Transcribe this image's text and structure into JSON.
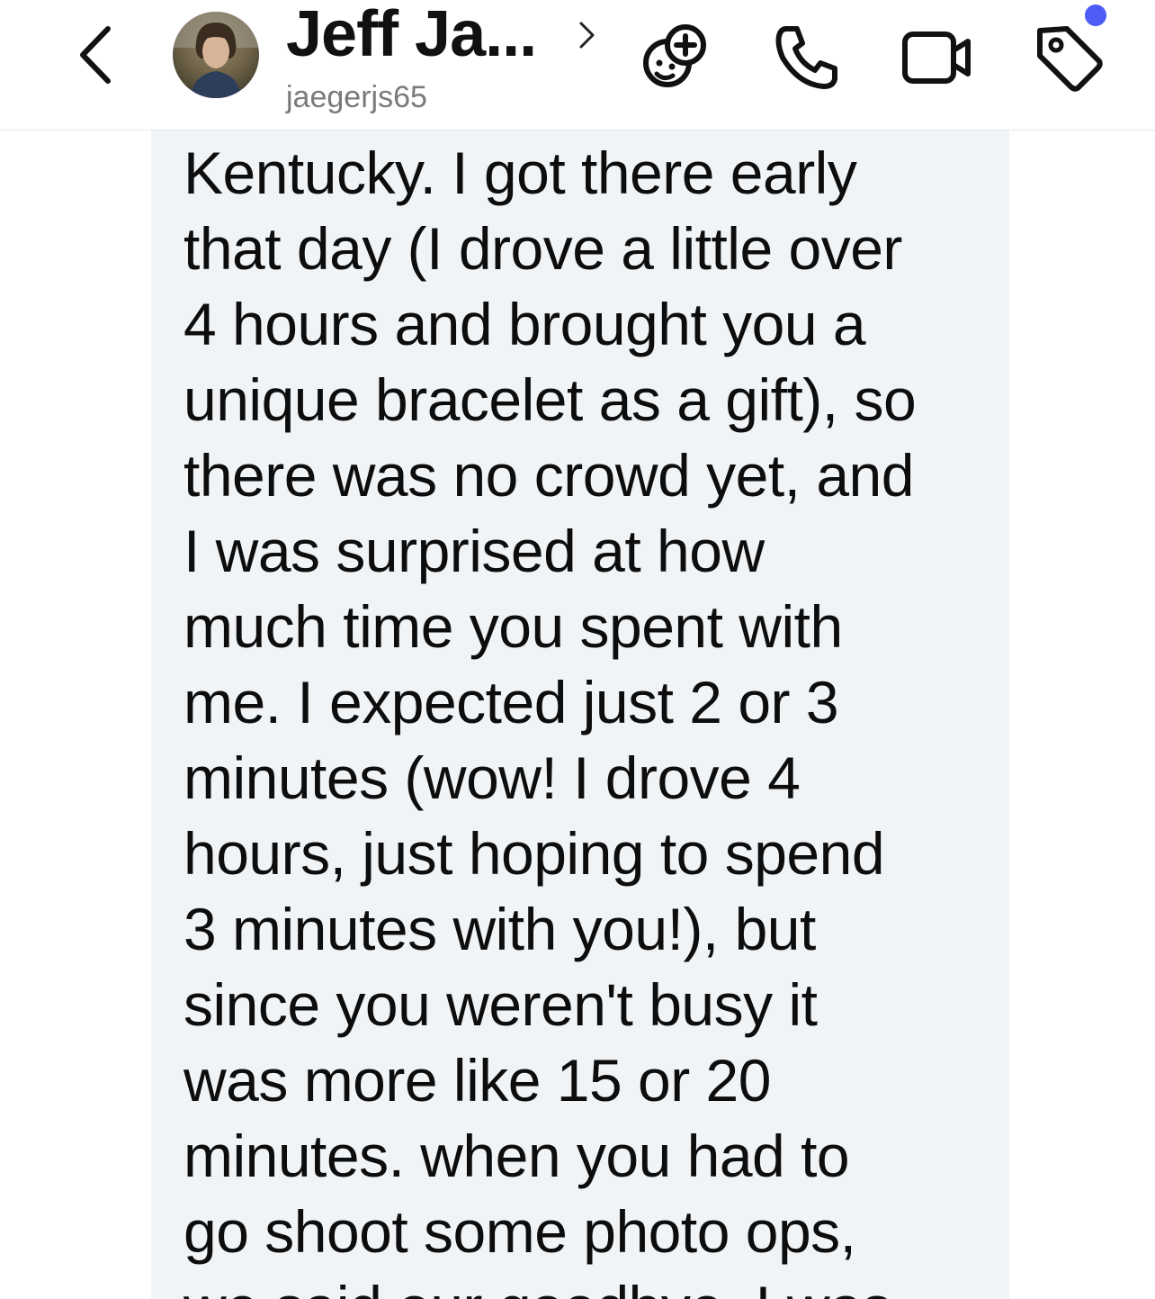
{
  "header": {
    "contact_name": "Jeff Ja...",
    "contact_handle": "jaegerjs65",
    "back_icon": "chevron-left-icon",
    "name_chevron_icon": "chevron-right-icon",
    "actions": [
      {
        "name": "bitmoji-add-icon"
      },
      {
        "name": "phone-icon"
      },
      {
        "name": "video-camera-icon"
      },
      {
        "name": "tag-icon"
      }
    ],
    "notification_dot_color": "#4f5bf5"
  },
  "message": {
    "bubble_color": "#f1f4f7",
    "lines": [
      "Kentucky. I got there early",
      "that day (I drove a little over",
      "4 hours and brought you a",
      "unique bracelet as a gift), so",
      "there was no crowd yet, and",
      "I was surprised at how",
      "much time you spent with",
      "me. I expected just 2 or 3",
      "minutes (wow! I drove 4",
      "hours, just hoping to spend",
      "3 minutes with you!), but",
      "since you weren't busy it",
      "was more like 15 or 20",
      "minutes. when you had to",
      "go shoot some photo ops,",
      "we said our goodbye. I was"
    ]
  }
}
